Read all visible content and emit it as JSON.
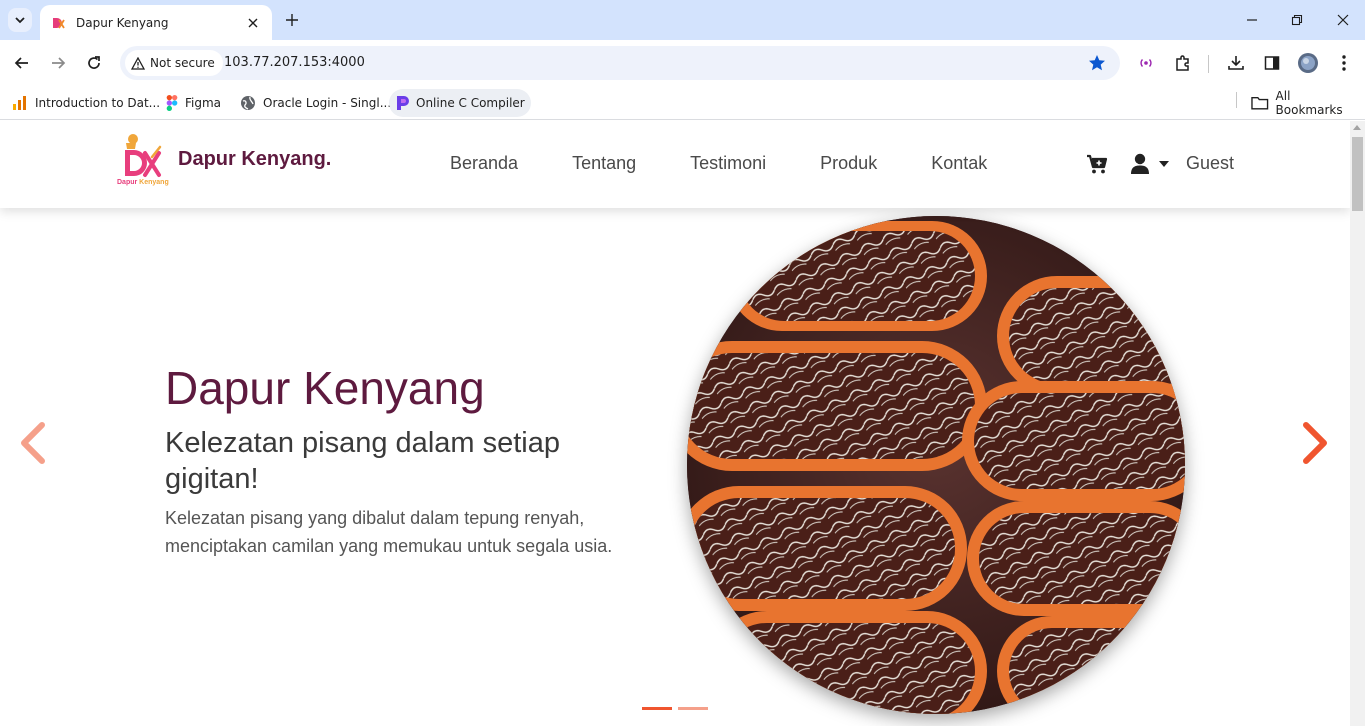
{
  "browser": {
    "tab_title": "Dapur Kenyang",
    "security_label": "Not secure",
    "url": "103.77.207.153:4000",
    "bookmarks": [
      {
        "label": "Introduction to Dat...",
        "icon": "analytics-icon"
      },
      {
        "label": "Figma",
        "icon": "figma-icon"
      },
      {
        "label": "Oracle Login - Singl...",
        "icon": "globe-icon"
      },
      {
        "label": "Online C Compiler",
        "icon": "compiler-icon"
      }
    ],
    "all_bookmarks": "All Bookmarks"
  },
  "site": {
    "brand": "Dapur Kenyang.",
    "logo_text": "Dapur Kenyang",
    "nav": [
      "Beranda",
      "Tentang",
      "Testimoni",
      "Produk",
      "Kontak"
    ],
    "user_label": "Guest"
  },
  "hero": {
    "title": "Dapur Kenyang",
    "subtitle": "Kelezatan pisang dalam setiap gigitan!",
    "description": "Kelezatan pisang yang dibalut dalam tepung renyah, menciptakan camilan yang memukau untuk segala usia.",
    "slide_count": 2,
    "active_slide": 1
  },
  "colors": {
    "brand": "#5e1a3f",
    "accent": "#f0552f",
    "accent_light": "#f5a08a",
    "tabstrip": "#d3e3fd",
    "star": "#0b57d0"
  }
}
